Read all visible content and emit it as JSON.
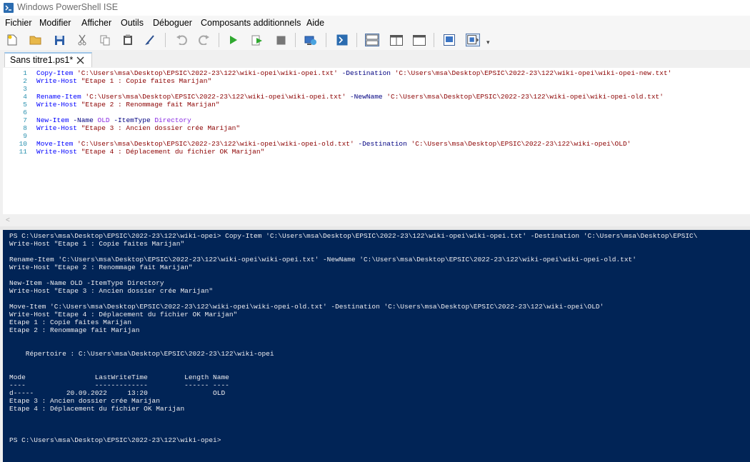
{
  "window": {
    "title": "Windows PowerShell ISE"
  },
  "menu": [
    "Fichier",
    "Modifier",
    "Afficher",
    "Outils",
    "Déboguer",
    "Composants additionnels",
    "Aide"
  ],
  "toolbar": {
    "icons": [
      "new-file-icon",
      "open-folder-icon",
      "save-icon",
      "cut-icon",
      "copy-icon",
      "paste-icon",
      "clear-console-icon",
      "undo-icon",
      "redo-icon",
      "run-script-icon",
      "run-selection-icon",
      "stop-icon",
      "new-remote-tab-icon",
      "start-powershell-icon",
      "show-script-top-icon",
      "show-script-right-icon",
      "show-script-max-icon",
      "show-command-window-icon",
      "show-command-addon-icon"
    ]
  },
  "tab": {
    "label": "Sans titre1.ps1*"
  },
  "editor": {
    "line_numbers": [
      "1",
      "2",
      "3",
      "4",
      "5",
      "6",
      "7",
      "8",
      "9",
      "10",
      "11"
    ],
    "lines": [
      [
        {
          "t": "cmd",
          "v": "Copy-Item"
        },
        {
          "t": "",
          "v": " "
        },
        {
          "t": "str",
          "v": "'C:\\Users\\msa\\Desktop\\EPSIC\\2022-23\\122\\wiki-opei\\wiki-opei.txt'"
        },
        {
          "t": "",
          "v": " "
        },
        {
          "t": "par",
          "v": "-Destination"
        },
        {
          "t": "",
          "v": " "
        },
        {
          "t": "str",
          "v": "'C:\\Users\\msa\\Desktop\\EPSIC\\2022-23\\122\\wiki-opei\\wiki-opei-new.txt'"
        }
      ],
      [
        {
          "t": "cmd",
          "v": "Write-Host"
        },
        {
          "t": "",
          "v": " "
        },
        {
          "t": "str",
          "v": "\"Etape 1 : Copie faites Marijan\""
        }
      ],
      [],
      [
        {
          "t": "cmd",
          "v": "Rename-Item"
        },
        {
          "t": "",
          "v": " "
        },
        {
          "t": "str",
          "v": "'C:\\Users\\msa\\Desktop\\EPSIC\\2022-23\\122\\wiki-opei\\wiki-opei.txt'"
        },
        {
          "t": "",
          "v": " "
        },
        {
          "t": "par",
          "v": "-NewName"
        },
        {
          "t": "",
          "v": " "
        },
        {
          "t": "str",
          "v": "'C:\\Users\\msa\\Desktop\\EPSIC\\2022-23\\122\\wiki-opei\\wiki-opei-old.txt'"
        }
      ],
      [
        {
          "t": "cmd",
          "v": "Write-Host"
        },
        {
          "t": "",
          "v": " "
        },
        {
          "t": "str",
          "v": "\"Etape 2 : Renommage fait Marijan\""
        }
      ],
      [],
      [
        {
          "t": "cmd",
          "v": "New-Item"
        },
        {
          "t": "",
          "v": " "
        },
        {
          "t": "par",
          "v": "-Name"
        },
        {
          "t": "",
          "v": " "
        },
        {
          "t": "typ",
          "v": "OLD"
        },
        {
          "t": "",
          "v": " "
        },
        {
          "t": "par",
          "v": "-ItemType"
        },
        {
          "t": "",
          "v": " "
        },
        {
          "t": "typ",
          "v": "Directory"
        }
      ],
      [
        {
          "t": "cmd",
          "v": "Write-Host"
        },
        {
          "t": "",
          "v": " "
        },
        {
          "t": "str",
          "v": "\"Etape 3 : Ancien dossier crée Marijan\""
        }
      ],
      [],
      [
        {
          "t": "cmd",
          "v": "Move-Item"
        },
        {
          "t": "",
          "v": " "
        },
        {
          "t": "str",
          "v": "'C:\\Users\\msa\\Desktop\\EPSIC\\2022-23\\122\\wiki-opei\\wiki-opei-old.txt'"
        },
        {
          "t": "",
          "v": " "
        },
        {
          "t": "par",
          "v": "-Destination"
        },
        {
          "t": "",
          "v": " "
        },
        {
          "t": "str",
          "v": "'C:\\Users\\msa\\Desktop\\EPSIC\\2022-23\\122\\wiki-opei\\OLD'"
        }
      ],
      [
        {
          "t": "cmd",
          "v": "Write-Host"
        },
        {
          "t": "",
          "v": " "
        },
        {
          "t": "str",
          "v": "\"Etape 4 : Déplacement du fichier OK Marijan\""
        }
      ]
    ]
  },
  "console": {
    "lines": [
      "PS C:\\Users\\msa\\Desktop\\EPSIC\\2022-23\\122\\wiki-opei> Copy-Item 'C:\\Users\\msa\\Desktop\\EPSIC\\2022-23\\122\\wiki-opei\\wiki-opei.txt' -Destination 'C:\\Users\\msa\\Desktop\\EPSIC\\",
      "Write-Host \"Etape 1 : Copie faites Marijan\"",
      "",
      "Rename-Item 'C:\\Users\\msa\\Desktop\\EPSIC\\2022-23\\122\\wiki-opei\\wiki-opei.txt' -NewName 'C:\\Users\\msa\\Desktop\\EPSIC\\2022-23\\122\\wiki-opei\\wiki-opei-old.txt'",
      "Write-Host \"Etape 2 : Renommage fait Marijan\"",
      "",
      "New-Item -Name OLD -ItemType Directory",
      "Write-Host \"Etape 3 : Ancien dossier crée Marijan\"",
      "",
      "Move-Item 'C:\\Users\\msa\\Desktop\\EPSIC\\2022-23\\122\\wiki-opei\\wiki-opei-old.txt' -Destination 'C:\\Users\\msa\\Desktop\\EPSIC\\2022-23\\122\\wiki-opei\\OLD'",
      "Write-Host \"Etape 4 : Déplacement du fichier OK Marijan\"",
      "Etape 1 : Copie faites Marijan",
      "Etape 2 : Renommage fait Marijan",
      "",
      "",
      "    Répertoire : C:\\Users\\msa\\Desktop\\EPSIC\\2022-23\\122\\wiki-opei",
      "",
      "",
      "Mode                 LastWriteTime         Length Name",
      "----                 -------------         ------ ----",
      "d-----        20.09.2022     13:20                OLD",
      "Etape 3 : Ancien dossier crée Marijan",
      "Etape 4 : Déplacement du fichier OK Marijan",
      "",
      "",
      "",
      "PS C:\\Users\\msa\\Desktop\\EPSIC\\2022-23\\122\\wiki-opei>"
    ]
  },
  "colors": {
    "console_bg": "#012456",
    "console_fg": "#eeedf0",
    "cmdlet": "#0000ff",
    "parameter": "#000080",
    "string": "#8b0000",
    "type": "#8a2be2",
    "line_number": "#2b91af"
  }
}
